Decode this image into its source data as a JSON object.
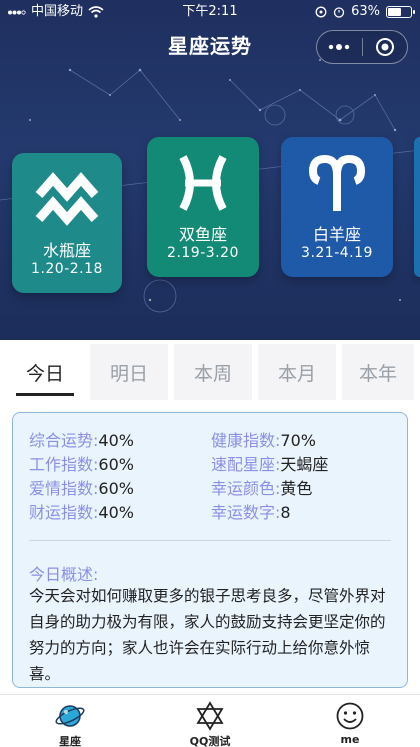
{
  "status_bar": {
    "carrier": "中国移动",
    "time": "下午2:11",
    "battery_text": "63%",
    "battery_level": 0.63
  },
  "header": {
    "title": "星座运势"
  },
  "signs": [
    {
      "name": "水瓶座",
      "date": "1.20-2.18",
      "symbol": "aquarius",
      "color": "#1f8a8a"
    },
    {
      "name": "双鱼座",
      "date": "2.19-3.20",
      "symbol": "pisces",
      "color": "#138a76"
    },
    {
      "name": "白羊座",
      "date": "3.21-4.19",
      "symbol": "aries",
      "color": "#1f5aa8"
    }
  ],
  "tabs": [
    {
      "label": "今日",
      "active": true
    },
    {
      "label": "明日",
      "active": false
    },
    {
      "label": "本周",
      "active": false
    },
    {
      "label": "本月",
      "active": false
    },
    {
      "label": "本年",
      "active": false
    }
  ],
  "fortune": {
    "items": [
      {
        "key": "综合运势",
        "value": "40%"
      },
      {
        "key": "健康指数",
        "value": "70%"
      },
      {
        "key": "工作指数",
        "value": "60%"
      },
      {
        "key": "速配星座",
        "value": "天蝎座"
      },
      {
        "key": "爱情指数",
        "value": "60%"
      },
      {
        "key": "幸运颜色",
        "value": "黄色"
      },
      {
        "key": "财运指数",
        "value": "40%"
      },
      {
        "key": "幸运数字",
        "value": "8"
      }
    ],
    "summary_label": "今日概述:",
    "summary_text": "今天会对如何赚取更多的银子思考良多，尽管外界对自身的助力极为有限，家人的鼓励支持会更坚定你的努力的方向；家人也许会在实际行动上给你意外惊喜。"
  },
  "bottom_nav": [
    {
      "label": "星座",
      "icon": "planet-icon"
    },
    {
      "label": "QQ测试",
      "icon": "star-of-david-icon"
    },
    {
      "label": "me",
      "icon": "smiley-icon"
    }
  ]
}
